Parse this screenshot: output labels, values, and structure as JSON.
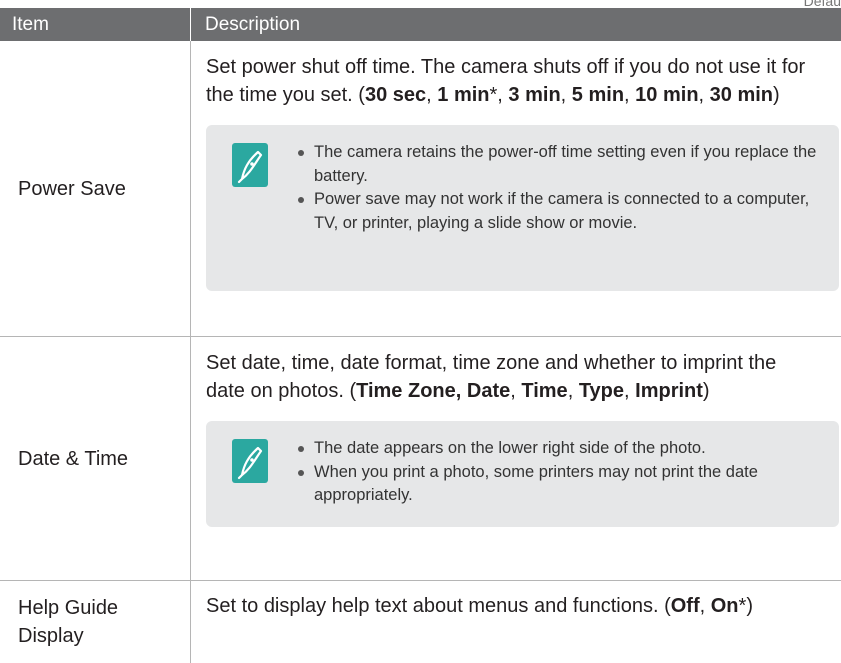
{
  "corner_label": "Defau",
  "header": {
    "item": "Item",
    "description": "Description"
  },
  "rows": [
    {
      "item_lines": [
        "Power Save"
      ],
      "description": [
        {
          "t": "Set power shut off time. The camera shuts off if you do not use it for the time you set. (",
          "b": false
        },
        {
          "t": "30 sec",
          "b": true
        },
        {
          "t": ", ",
          "b": false
        },
        {
          "t": "1 min",
          "b": true
        },
        {
          "t": "*, ",
          "b": false
        },
        {
          "t": "3 min",
          "b": true
        },
        {
          "t": ", ",
          "b": false
        },
        {
          "t": "5 min",
          "b": true
        },
        {
          "t": ", ",
          "b": false
        },
        {
          "t": "10 min",
          "b": true
        },
        {
          "t": ", ",
          "b": false
        },
        {
          "t": "30 min",
          "b": true
        },
        {
          "t": ")",
          "b": false
        }
      ],
      "notes": [
        "The camera retains the power-off time setting even if you replace the battery.",
        "Power save may not work if the camera is connected to a computer, TV, or printer, playing a slide show or movie."
      ]
    },
    {
      "item_lines": [
        "Date & Time"
      ],
      "description": [
        {
          "t": "Set date, time, date format, time zone and whether to imprint the date on photos. (",
          "b": false
        },
        {
          "t": "Time Zone, Date",
          "b": true
        },
        {
          "t": ", ",
          "b": false
        },
        {
          "t": "Time",
          "b": true
        },
        {
          "t": ", ",
          "b": false
        },
        {
          "t": "Type",
          "b": true
        },
        {
          "t": ", ",
          "b": false
        },
        {
          "t": "Imprint",
          "b": true
        },
        {
          "t": ")",
          "b": false
        }
      ],
      "notes": [
        "The date appears on the lower right side of the photo.",
        "When you print a photo, some printers may not print the date appropriately."
      ]
    },
    {
      "item_lines": [
        "Help Guide",
        "Display"
      ],
      "description": [
        {
          "t": "Set to display help text about menus and functions. (",
          "b": false
        },
        {
          "t": "Off",
          "b": true
        },
        {
          "t": ", ",
          "b": false
        },
        {
          "t": "On",
          "b": true
        },
        {
          "t": "*)",
          "b": false
        }
      ],
      "notes": []
    }
  ],
  "icon": "note-pen-icon",
  "colors": {
    "header_bg": "#6d6e70",
    "note_bg": "#e6e7e8",
    "icon_bg": "#2ba8a0"
  }
}
